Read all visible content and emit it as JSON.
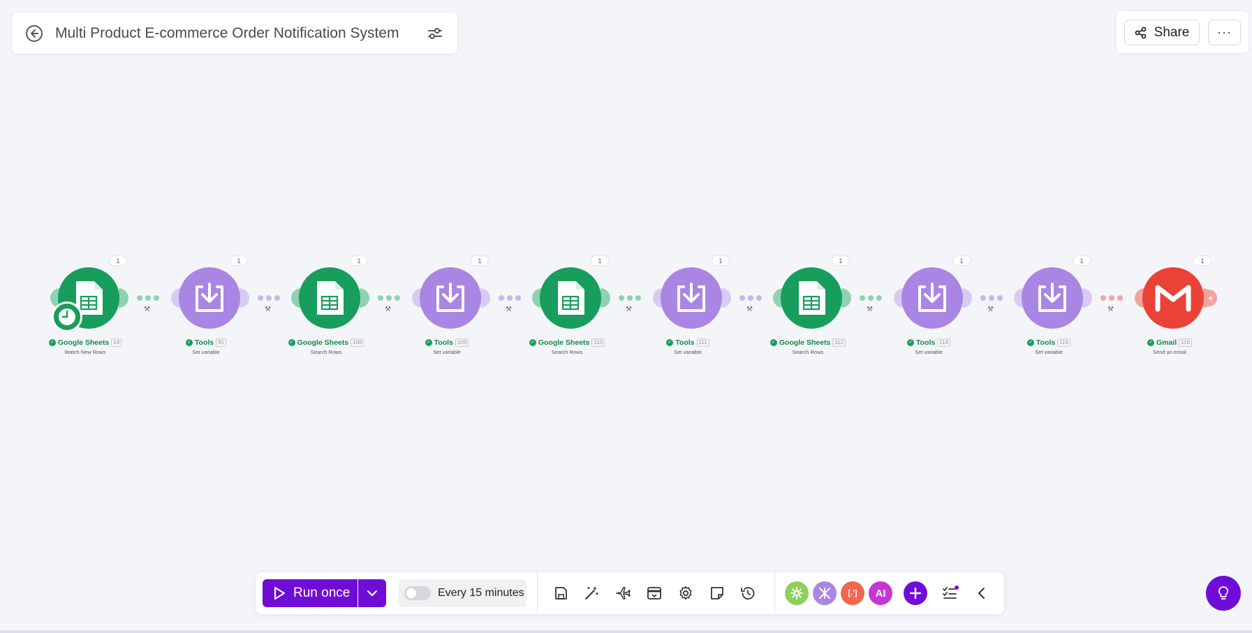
{
  "header": {
    "title": "Multi Product E-commerce Order Notification System"
  },
  "topbar": {
    "share_label": "Share",
    "more_label": "···"
  },
  "modules": [
    {
      "app": "Google Sheets",
      "id": "14",
      "action": "Watch New Rows",
      "ops": "1",
      "kind": "sheets"
    },
    {
      "app": "Tools",
      "id": "91",
      "action": "Set variable",
      "ops": "1",
      "kind": "tools"
    },
    {
      "app": "Google Sheets",
      "id": "108",
      "action": "Search Rows",
      "ops": "1",
      "kind": "sheets"
    },
    {
      "app": "Tools",
      "id": "109",
      "action": "Set variable",
      "ops": "1",
      "kind": "tools"
    },
    {
      "app": "Google Sheets",
      "id": "110",
      "action": "Search Rows",
      "ops": "1",
      "kind": "sheets"
    },
    {
      "app": "Tools",
      "id": "111",
      "action": "Set variable",
      "ops": "1",
      "kind": "tools"
    },
    {
      "app": "Google Sheets",
      "id": "112",
      "action": "Search Rows",
      "ops": "1",
      "kind": "sheets"
    },
    {
      "app": "Tools",
      "id": "114",
      "action": "Set variable",
      "ops": "1",
      "kind": "tools"
    },
    {
      "app": "Tools",
      "id": "115",
      "action": "Set variable",
      "ops": "1",
      "kind": "tools"
    },
    {
      "app": "Gmail",
      "id": "116",
      "action": "Send an email",
      "ops": "1",
      "kind": "gmail"
    }
  ],
  "toolbar": {
    "run_label": "Run once",
    "schedule_label": "Every 15 minutes",
    "flow_control_label": "[.']",
    "ai_label": "AI"
  },
  "colors": {
    "sheets": "#179d5c",
    "tools": "#a986e3",
    "gmail": "#ea4236",
    "accent": "#6f0dd6"
  }
}
